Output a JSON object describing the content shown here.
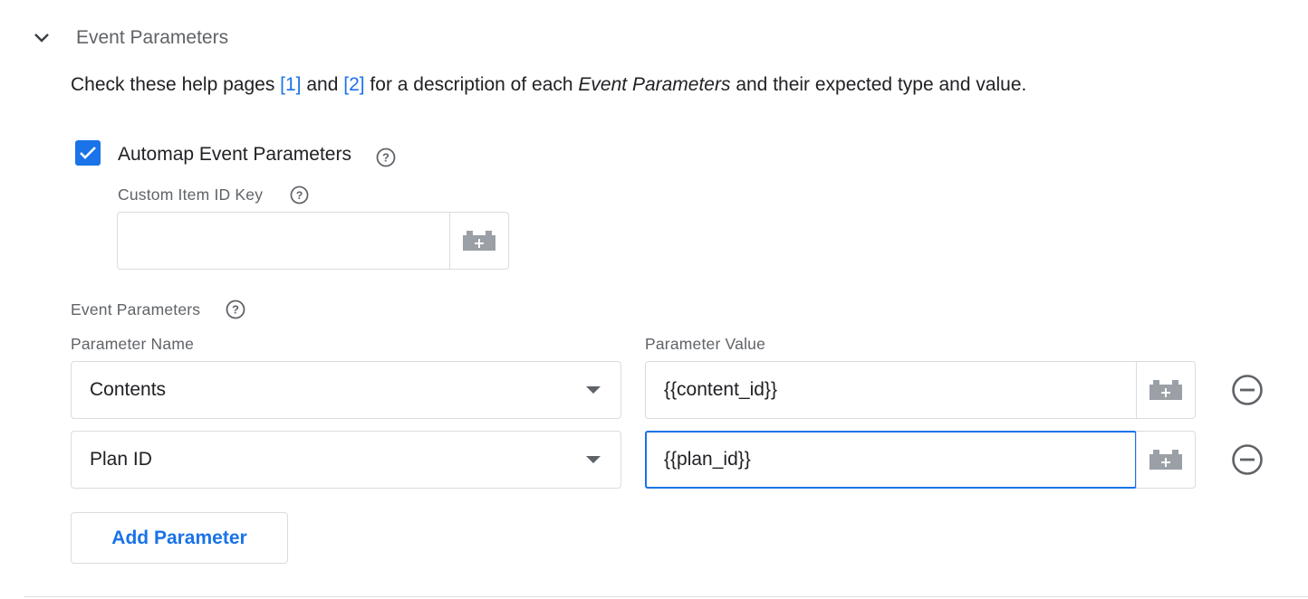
{
  "section": {
    "title": "Event Parameters",
    "help_text": {
      "prefix": "Check these help pages ",
      "link1": "[1]",
      "middle": " and ",
      "link2": "[2]",
      "after_links": " for a description of each ",
      "emphasis": "Event Parameters",
      "suffix": " and their expected type and value."
    }
  },
  "automap": {
    "label": "Automap Event Parameters",
    "checked": true
  },
  "custom_item_id": {
    "label": "Custom Item ID Key",
    "value": ""
  },
  "event_params": {
    "label": "Event Parameters",
    "name_header": "Parameter Name",
    "value_header": "Parameter Value",
    "rows": [
      {
        "name": "Contents",
        "value": "{{content_id}}"
      },
      {
        "name": "Plan ID",
        "value": "{{plan_id}}"
      }
    ],
    "add_label": "Add Parameter"
  },
  "colors": {
    "accent": "#1a73e8",
    "border": "#dadce0",
    "muted_text": "#5f6368"
  }
}
